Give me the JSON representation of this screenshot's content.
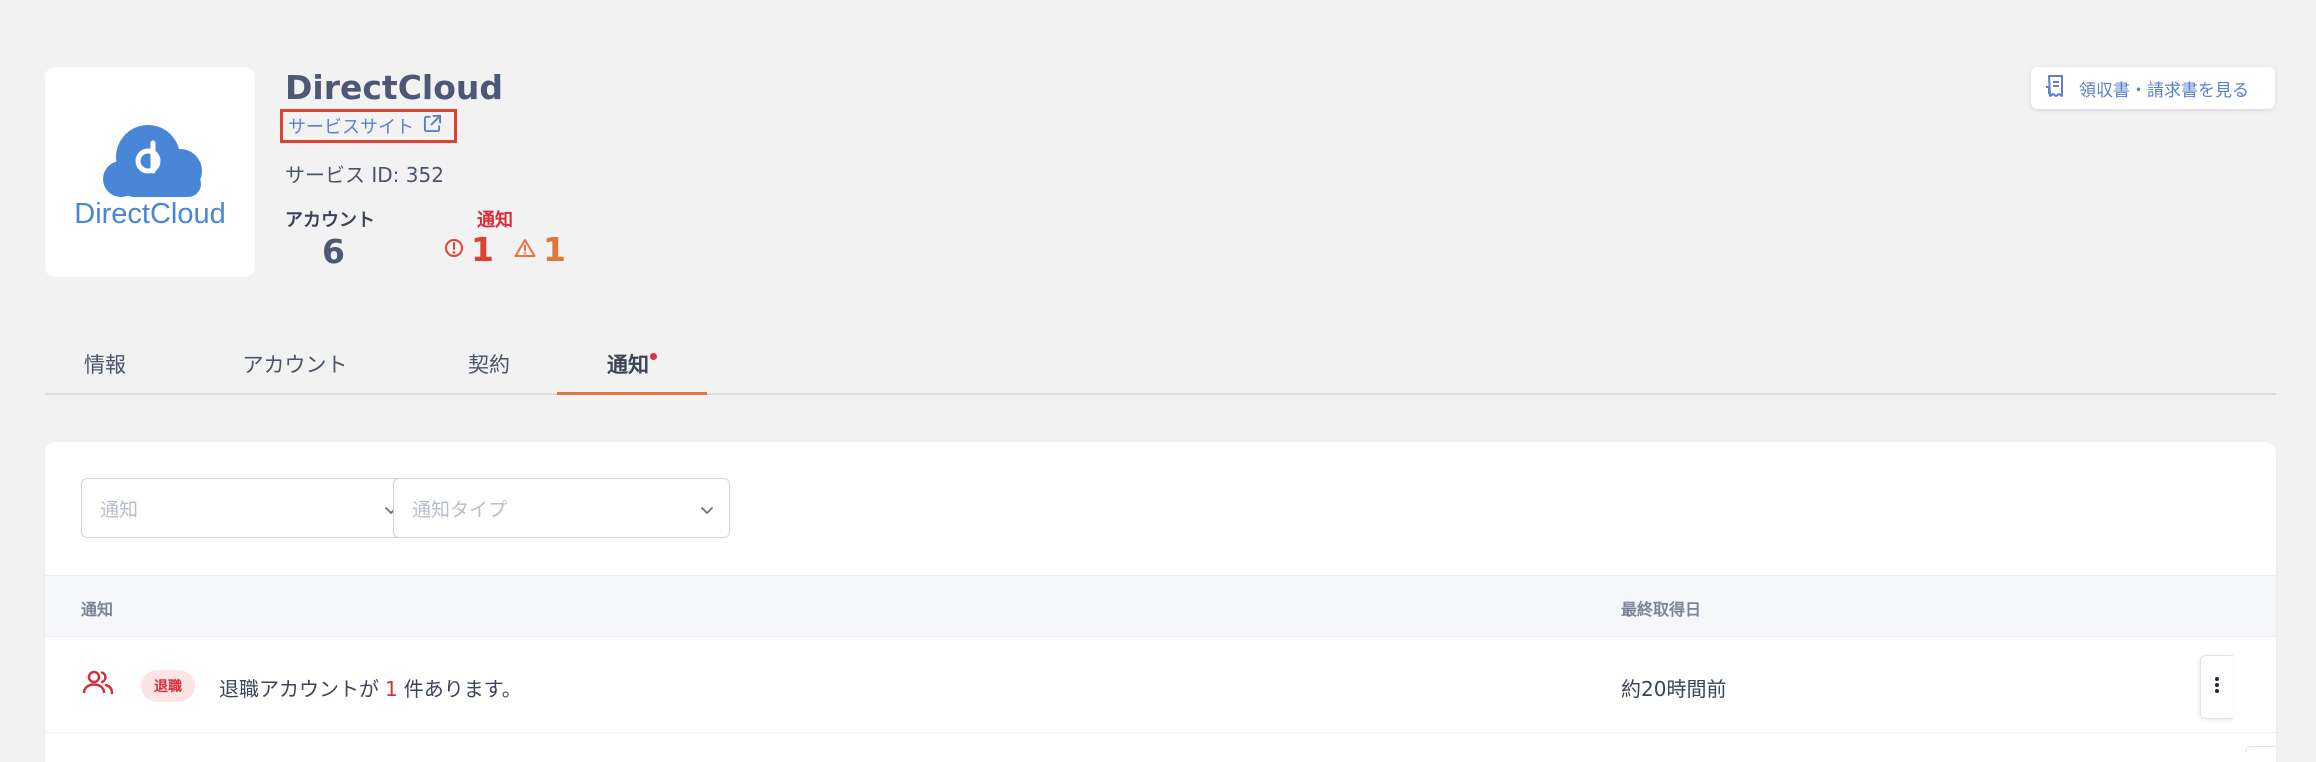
{
  "service": {
    "name": "DirectCloud",
    "site_link_label": "サービスサイト",
    "id_text": "サービス ID: 352",
    "logo_text": "DirectCloud"
  },
  "stats": {
    "accounts_label": "アカウント",
    "accounts_value": "6",
    "alerts_label": "通知",
    "error_count": "1",
    "warning_count": "1"
  },
  "receipt_button_label": "領収書・請求書を見る",
  "tabs": [
    {
      "label": "情報",
      "active": false
    },
    {
      "label": "アカウント",
      "active": false
    },
    {
      "label": "契約",
      "active": false
    },
    {
      "label": "通知",
      "active": true,
      "has_dot": true
    }
  ],
  "filters": {
    "alert_placeholder": "通知",
    "type_placeholder": "通知タイプ"
  },
  "table": {
    "columns": [
      "通知",
      "最終取得日"
    ],
    "rows": [
      {
        "badge": "退職",
        "message_prefix": "退職アカウントが",
        "count": "1",
        "message_suffix": "件あります。",
        "date": "約20時間前"
      }
    ]
  },
  "colors": {
    "link": "#5b7fcf",
    "error": "#e0412e",
    "warning": "#e0783c",
    "active_tab_underline": "#e0783c",
    "badge_bg": "#fde5e5"
  }
}
